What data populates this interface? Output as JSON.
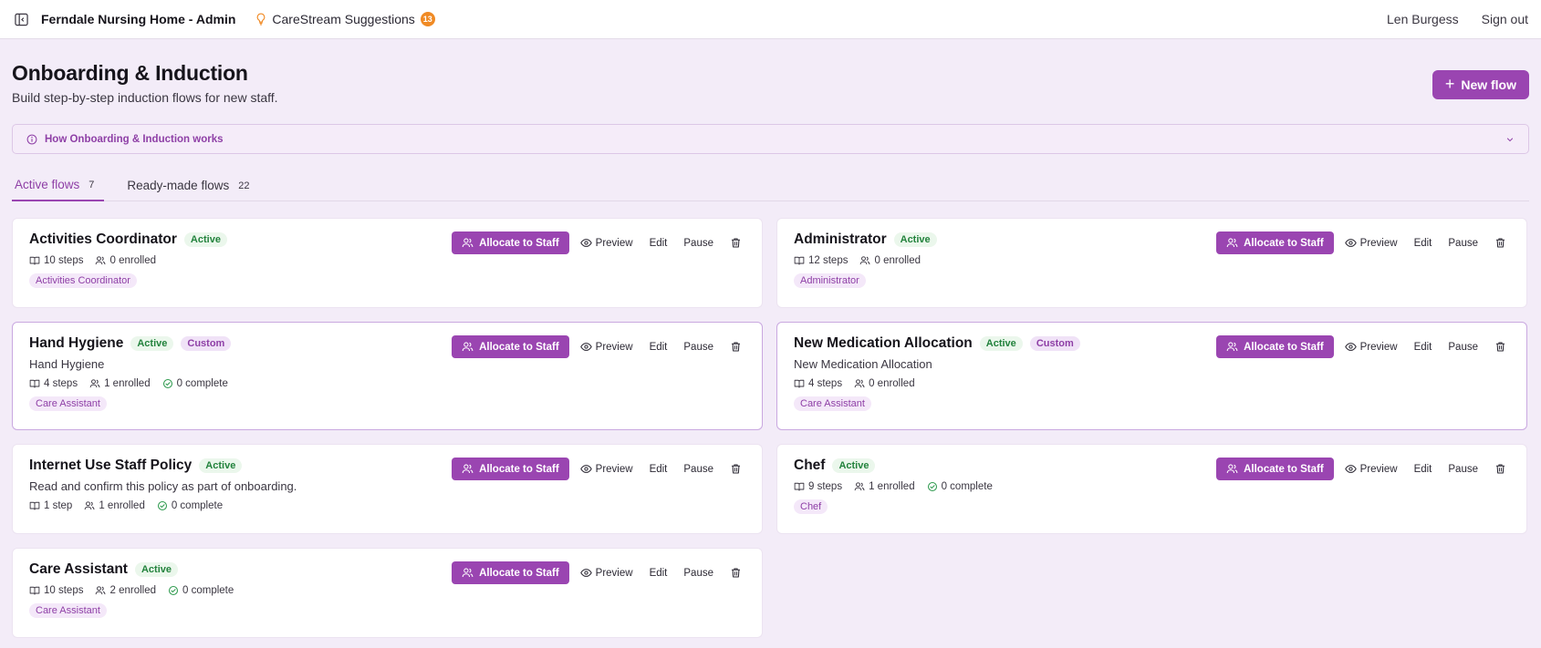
{
  "topbar": {
    "app_title": "Ferndale Nursing Home - Admin",
    "suggestions_label": "CareStream Suggestions",
    "suggestions_count": "13",
    "user_name": "Len Burgess",
    "signout_label": "Sign out"
  },
  "header": {
    "title": "Onboarding & Induction",
    "subtitle": "Build step-by-step induction flows for new staff.",
    "new_flow_label": "New flow"
  },
  "info_bar": {
    "label": "How Onboarding & Induction works"
  },
  "tabs": [
    {
      "label": "Active flows",
      "count": "7"
    },
    {
      "label": "Ready-made flows",
      "count": "22"
    }
  ],
  "card_actions": {
    "allocate": "Allocate to Staff",
    "preview": "Preview",
    "edit": "Edit",
    "pause": "Pause"
  },
  "badges": {
    "active": "Active",
    "custom": "Custom"
  },
  "cards": [
    {
      "title": "Activities Coordinator",
      "steps": "10 steps",
      "enrolled": "0 enrolled",
      "tag": "Activities Coordinator"
    },
    {
      "title": "Administrator",
      "steps": "12 steps",
      "enrolled": "0 enrolled",
      "tag": "Administrator"
    },
    {
      "title": "Hand Hygiene",
      "description": "Hand Hygiene",
      "steps": "4 steps",
      "enrolled": "1 enrolled",
      "complete": "0 complete",
      "tag": "Care Assistant"
    },
    {
      "title": "New Medication Allocation",
      "description": "New Medication Allocation",
      "steps": "4 steps",
      "enrolled": "0 enrolled",
      "tag": "Care Assistant"
    },
    {
      "title": "Internet Use Staff Policy",
      "description": "Read and confirm this policy as part of onboarding.",
      "steps": "1 step",
      "enrolled": "1 enrolled",
      "complete": "0 complete"
    },
    {
      "title": "Chef",
      "steps": "9 steps",
      "enrolled": "1 enrolled",
      "complete": "0 complete",
      "tag": "Chef"
    },
    {
      "title": "Care Assistant",
      "steps": "10 steps",
      "enrolled": "2 enrolled",
      "complete": "0 complete",
      "tag": "Care Assistant"
    }
  ]
}
